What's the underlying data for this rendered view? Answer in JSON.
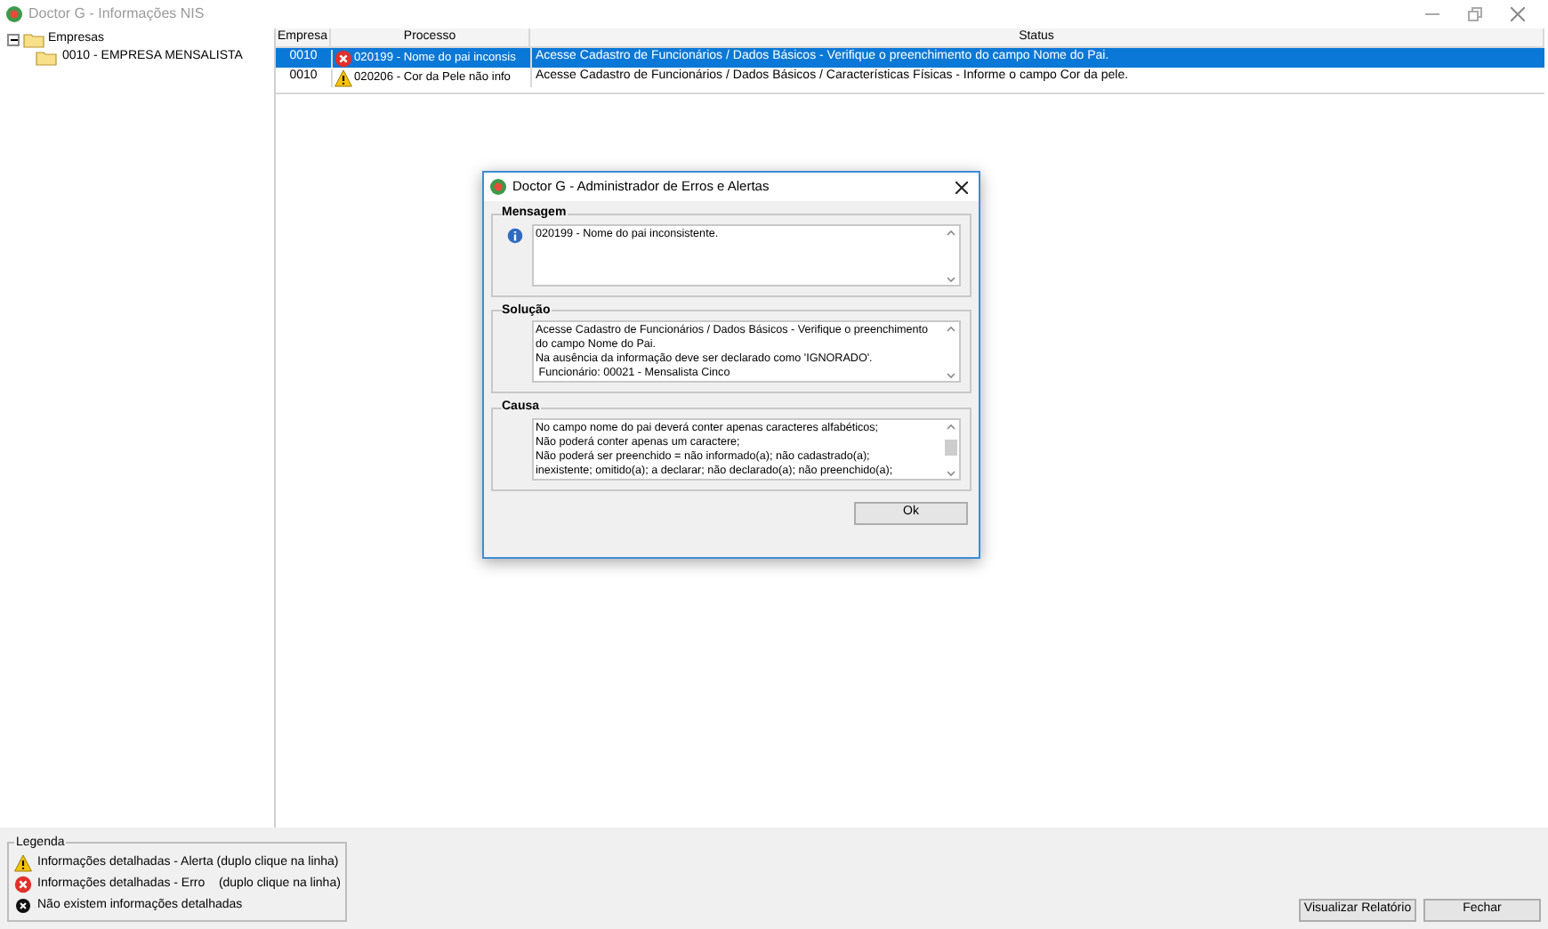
{
  "window": {
    "title": "Doctor G - Informações NIS"
  },
  "tree": {
    "label": "Empresas",
    "expanded": true,
    "children": [
      {
        "label": "0010 - EMPRESA MENSALISTA"
      }
    ]
  },
  "table": {
    "columns": [
      "Empresa",
      "Processo",
      "Status"
    ],
    "rows": [
      {
        "empresa": "0010",
        "kind": "error",
        "processo": "020199 - Nome do pai inconsis",
        "status": "Acesse Cadastro de Funcionários / Dados Básicos - Verifique o preenchimento do campo Nome do Pai.",
        "selected": true
      },
      {
        "empresa": "0010",
        "kind": "alert",
        "processo": "020206 - Cor da Pele não info",
        "status": "Acesse Cadastro de Funcionários / Dados Básicos / Características Físicas - Informe o campo Cor da pele.",
        "selected": false
      }
    ]
  },
  "legend": {
    "title": "Legenda",
    "items": [
      {
        "kind": "alert",
        "label": "Informações detalhadas - Alerta (duplo clique na linha)"
      },
      {
        "kind": "error",
        "label": "Informações detalhadas - Erro    (duplo clique na linha)"
      },
      {
        "kind": "none",
        "label": "Não existem informações detalhadas"
      }
    ]
  },
  "buttons": [
    "Visualizar Relatório",
    "Fechar"
  ],
  "dialog": {
    "title": "Doctor G - Administrador de Erros e Alertas",
    "sections": [
      {
        "title": "Mensagem",
        "kind": "info",
        "text": "020199 - Nome do pai inconsistente."
      },
      {
        "title": "Solução",
        "text": "Acesse Cadastro de Funcionários / Dados Básicos - Verifique o preenchimento\ndo campo Nome do Pai.\nNa ausência da informação deve ser declarado como 'IGNORADO'.\n Funcionário: 00021 - Mensalista Cinco"
      },
      {
        "title": "Causa",
        "text": "No campo nome do pai deverá conter apenas caracteres alfabéticos;\nNão poderá conter apenas um caractere;\nNão poderá ser preenchido = não informado(a); não cadastrado(a);\ninexistente; omitido(a); a declarar; não declarado(a); não preenchido(a);"
      }
    ],
    "button": "Ok"
  }
}
